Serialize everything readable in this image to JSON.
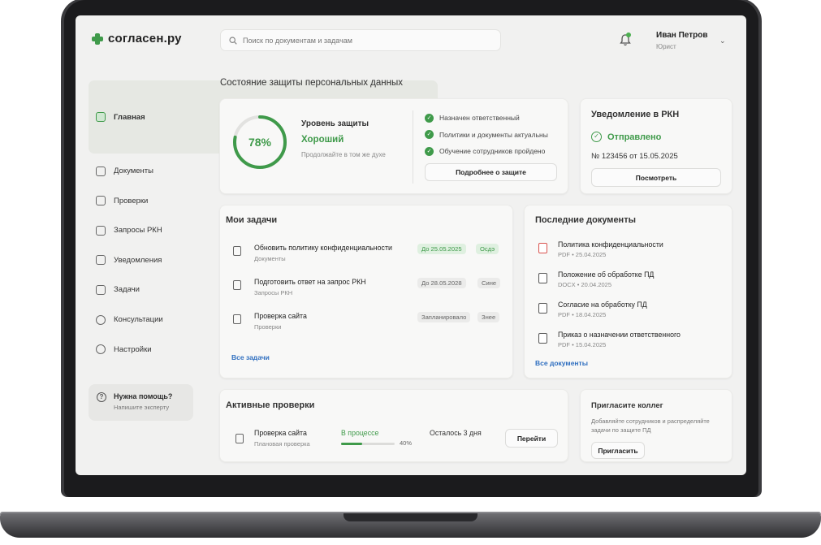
{
  "app": {
    "logo_text": "согласен.ру"
  },
  "search": {
    "placeholder": "Поиск по документам и задачам"
  },
  "user": {
    "name": "Иван Петров",
    "role": "Юрист"
  },
  "sidebar": {
    "items": [
      {
        "label": "Главная",
        "icon": "home-icon",
        "active": true
      },
      {
        "label": "Документы",
        "icon": "document-icon"
      },
      {
        "label": "Проверки",
        "icon": "check-icon"
      },
      {
        "label": "Запросы РКН",
        "icon": "request-icon"
      },
      {
        "label": "Уведомления",
        "icon": "bell-icon"
      },
      {
        "label": "Задачи",
        "icon": "calendar-icon"
      },
      {
        "label": "Консультации",
        "icon": "chat-icon"
      },
      {
        "label": "Настройки",
        "icon": "gear-icon"
      }
    ],
    "help": {
      "title": "Нужна помощь?",
      "subtitle": "Напишите эксперту"
    }
  },
  "main": {
    "section_title": "Состояние защиты персональных данных",
    "protection": {
      "percent": 78,
      "percent_label": "78%",
      "label": "Уровень защиты",
      "status": "Хороший",
      "hint": "Продолжайте в том же духе",
      "checks": [
        "Назначен ответственный",
        "Политики и документы актуальны",
        "Обучение сотрудников пройдено"
      ],
      "button": "Подробнее о защите"
    },
    "rkn": {
      "title": "Уведомление в РКН",
      "status": "Отправлено",
      "number": "№ 123456 от 15.05.2025",
      "button": "Посмотреть"
    },
    "tasks": {
      "title": "Мои задачи",
      "items": [
        {
          "name": "Обновить политику конфиденциальности",
          "category": "Документы",
          "due": "До 25.05.2025",
          "badge": "Осдэ"
        },
        {
          "name": "Подготовить ответ на запрос РКН",
          "category": "Запросы РКН",
          "due": "До 28.05.2028",
          "badge": "Сине"
        },
        {
          "name": "Проверка сайта",
          "category": "Проверки",
          "due": "Запланировало",
          "badge": "Знее"
        }
      ],
      "see_all": "Все задачи"
    },
    "documents": {
      "title": "Последние документы",
      "items": [
        {
          "name": "Политика конфиденциальности",
          "meta": "PDF • 25.04.2025"
        },
        {
          "name": "Положение об обработке ПД",
          "meta": "DOCX • 20.04.2025"
        },
        {
          "name": "Согласие на обработку ПД",
          "meta": "PDF • 18.04.2025"
        },
        {
          "name": "Приказ о назначении ответственного",
          "meta": "PDF • 15.04.2025"
        }
      ],
      "see_all": "Все документы"
    },
    "active_checks": {
      "title": "Активные проверки",
      "item": {
        "name": "Проверка сайта",
        "type": "Плановая проверка",
        "status": "В процессе",
        "progress": 0.4,
        "progress_label": "40%",
        "remaining": "Осталось 3 дня",
        "button": "Перейти"
      }
    },
    "invite": {
      "title": "Пригласите коллег",
      "text": "Добавляйте сотрудников и распределяйте задачи по защите ПД",
      "button": "Пригласить"
    }
  },
  "colors": {
    "accent": "#3f9a4a",
    "link": "#2f6fc0",
    "danger": "#d9534f"
  }
}
